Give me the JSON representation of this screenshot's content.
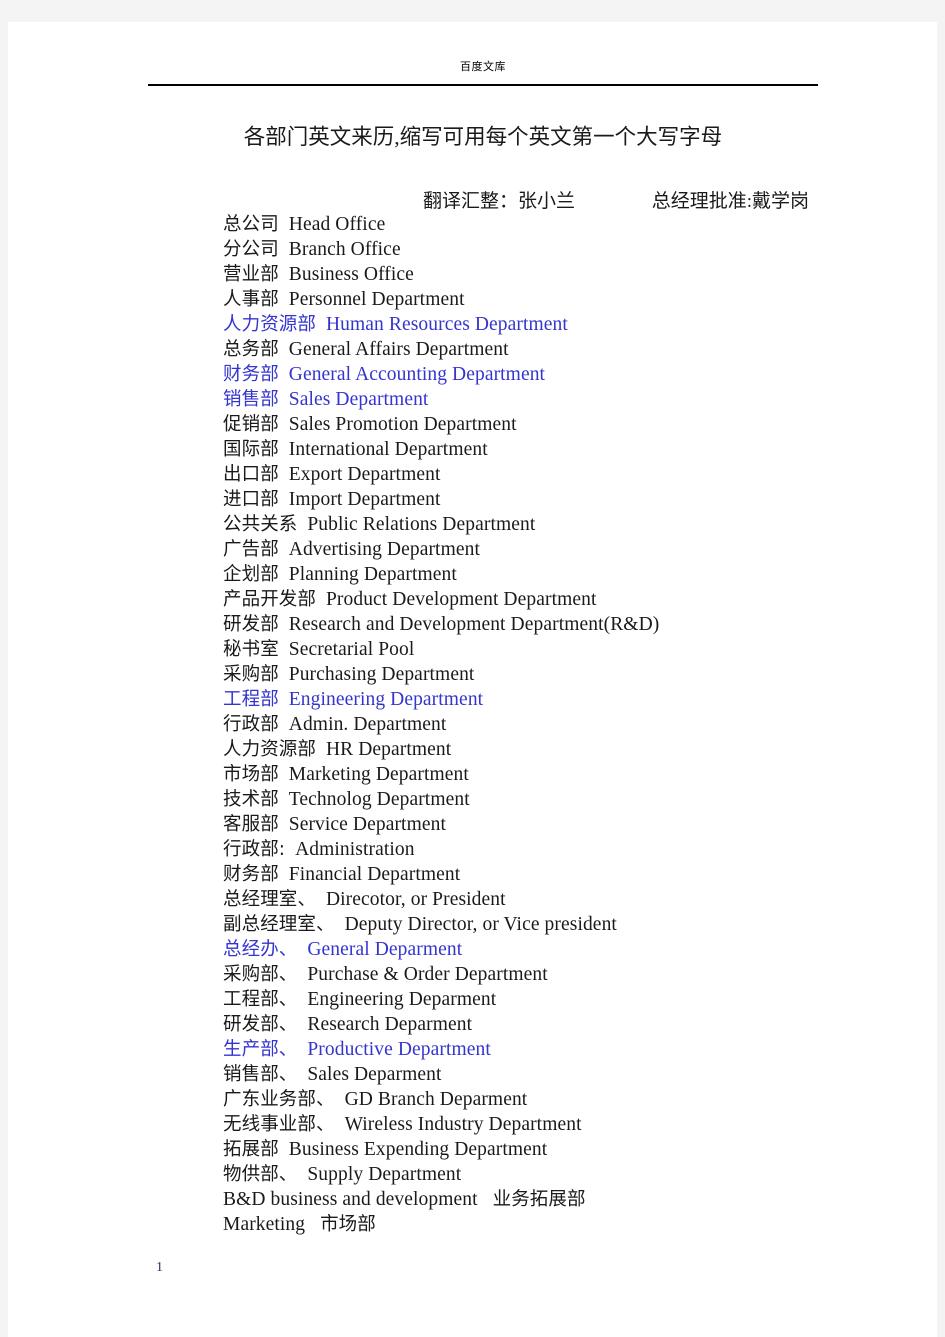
{
  "header": {
    "brand": "百度文库"
  },
  "title": "各部门英文来历,缩写可用每个英文第一个大写字母",
  "byline": {
    "translator": "翻译汇整：张小兰",
    "approver": "总经理批准:戴学岗"
  },
  "colors": {
    "body_text": "#1a1a1a",
    "highlight_blue": "#3434cf",
    "page_number": "#22366c",
    "background": "#f4f4f4",
    "page": "#ffffff"
  },
  "footer": {
    "page_number": "1"
  },
  "entries": [
    {
      "cn": "总公司",
      "en": "Head  Office",
      "highlight": false
    },
    {
      "cn": "分公司",
      "en": "Branch  Office",
      "highlight": false
    },
    {
      "cn": "营业部",
      "en": "Business  Office",
      "highlight": false
    },
    {
      "cn": "人事部",
      "en": "Personnel  Department",
      "highlight": false
    },
    {
      "cn": "人力资源部",
      "en": "Human  Resources  Department",
      "highlight": true
    },
    {
      "cn": "总务部",
      "en": "General  Affairs  Department",
      "highlight": false
    },
    {
      "cn": "财务部",
      "en": "General  Accounting  Department",
      "highlight": true
    },
    {
      "cn": "销售部",
      "en": "Sales  Department",
      "highlight": true
    },
    {
      "cn": "促销部",
      "en": "Sales  Promotion  Department",
      "highlight": false
    },
    {
      "cn": "国际部",
      "en": "International  Department",
      "highlight": false
    },
    {
      "cn": "出口部",
      "en": "Export  Department",
      "highlight": false
    },
    {
      "cn": "进口部",
      "en": "Import  Department",
      "highlight": false
    },
    {
      "cn": "公共关系",
      "en": "Public  Relations  Department",
      "highlight": false
    },
    {
      "cn": "广告部",
      "en": "Advertising  Department",
      "highlight": false
    },
    {
      "cn": "企划部",
      "en": "Planning  Department",
      "highlight": false
    },
    {
      "cn": "产品开发部",
      "en": "Product  Development  Department",
      "highlight": false
    },
    {
      "cn": "研发部",
      "en": "Research  and  Development  Department(R&D)",
      "highlight": false
    },
    {
      "cn": "秘书室",
      "en": "Secretarial  Pool",
      "highlight": false
    },
    {
      "cn": "采购部",
      "en": "Purchasing  Department",
      "highlight": false
    },
    {
      "cn": "工程部",
      "en": "Engineering  Department",
      "highlight": true
    },
    {
      "cn": "行政部",
      "en": "Admin.  Department",
      "highlight": false
    },
    {
      "cn": "人力资源部",
      "en": "HR  Department",
      "highlight": false
    },
    {
      "cn": "市场部",
      "en": "Marketing  Department",
      "highlight": false
    },
    {
      "cn": "技术部",
      "en": "Technolog  Department",
      "highlight": false
    },
    {
      "cn": "客服部",
      "en": "Service  Department",
      "highlight": false
    },
    {
      "cn": "行政部:",
      "en": "Administration",
      "highlight": false
    },
    {
      "cn": "财务部",
      "en": "Financial  Department",
      "highlight": false
    },
    {
      "cn": "总经理室、",
      "en": "Direcotor,  or  President",
      "highlight": false
    },
    {
      "cn": "副总经理室、",
      "en": "Deputy  Director,  or  Vice  president",
      "highlight": false
    },
    {
      "cn": "总经办、",
      "en": "General  Deparment",
      "highlight": true
    },
    {
      "cn": "采购部、",
      "en": "Purchase  &  Order  Department",
      "highlight": false
    },
    {
      "cn": "工程部、",
      "en": "Engineering  Deparment",
      "highlight": false
    },
    {
      "cn": "研发部、",
      "en": "Research  Deparment",
      "highlight": false
    },
    {
      "cn": "生产部、",
      "en": "Productive  Department",
      "highlight": true
    },
    {
      "cn": "销售部、",
      "en": "Sales  Deparment",
      "highlight": false
    },
    {
      "cn": "广东业务部、",
      "en": "GD  Branch  Deparment",
      "highlight": false
    },
    {
      "cn": "无线事业部、",
      "en": "Wireless  Industry  Department",
      "highlight": false
    },
    {
      "cn": "拓展部",
      "en": "Business  Expending  Department",
      "highlight": false
    },
    {
      "cn": "物供部、",
      "en": "Supply  Department",
      "highlight": false
    },
    {
      "cn": "",
      "en": "B&D  business  and  development",
      "cn_after": "业务拓展部",
      "highlight": false
    },
    {
      "cn": "",
      "en": "Marketing",
      "cn_after": "市场部",
      "highlight": false
    }
  ]
}
